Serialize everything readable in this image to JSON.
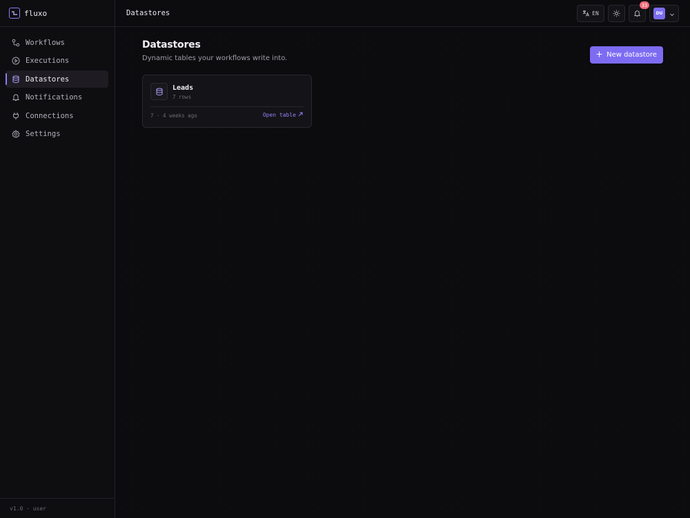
{
  "brand": {
    "name": "fluxo",
    "accent": "#8b7cf6"
  },
  "sidebar": {
    "items": [
      {
        "label": "Workflows",
        "icon": "workflow-icon",
        "active": false
      },
      {
        "label": "Executions",
        "icon": "play-circle-icon",
        "active": false
      },
      {
        "label": "Datastores",
        "icon": "database-icon",
        "active": true
      },
      {
        "label": "Notifications",
        "icon": "bell-icon",
        "active": false
      },
      {
        "label": "Connections",
        "icon": "plug-icon",
        "active": false
      },
      {
        "label": "Settings",
        "icon": "gear-icon",
        "active": false
      }
    ],
    "footer": "v1.0 · user"
  },
  "header": {
    "title": "Datastores",
    "language": "EN",
    "notification_count": "33",
    "user_initials": "DU"
  },
  "main": {
    "title": "Datastores",
    "subtitle": "Dynamic tables your workflows write into.",
    "new_button_label": "New datastore",
    "cards": [
      {
        "name": "Leads",
        "rows": "7 rows",
        "meta": "7 · 4 weeks ago",
        "link": "Open table"
      }
    ]
  }
}
